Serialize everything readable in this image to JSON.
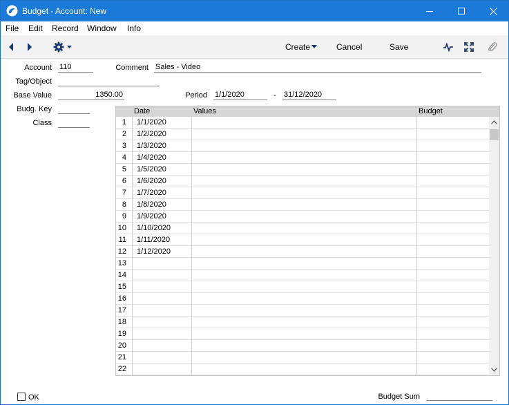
{
  "window": {
    "title": "Budget - Account: New"
  },
  "menu": [
    "File",
    "Edit",
    "Record",
    "Window",
    "Info"
  ],
  "toolbar": {
    "create_label": "Create",
    "cancel_label": "Cancel",
    "save_label": "Save"
  },
  "form": {
    "account_label": "Account",
    "account_value": "110",
    "comment_label": "Comment",
    "comment_value": "Sales - Video",
    "tag_label": "Tag/Object",
    "tag_value": "",
    "base_value_label": "Base Value",
    "base_value": "1350.00",
    "period_label": "Period",
    "period_from": "1/1/2020",
    "period_sep": "-",
    "period_to": "31/12/2020",
    "budg_key_label": "Budg. Key",
    "budg_key_value": "",
    "class_label": "Class",
    "class_value": ""
  },
  "grid": {
    "headers": {
      "date": "Date",
      "values": "Values",
      "budget": "Budget"
    },
    "rows": [
      {
        "num": "1",
        "date": "1/1/2020",
        "values": "",
        "budget": ""
      },
      {
        "num": "2",
        "date": "1/2/2020",
        "values": "",
        "budget": ""
      },
      {
        "num": "3",
        "date": "1/3/2020",
        "values": "",
        "budget": ""
      },
      {
        "num": "4",
        "date": "1/4/2020",
        "values": "",
        "budget": ""
      },
      {
        "num": "5",
        "date": "1/5/2020",
        "values": "",
        "budget": ""
      },
      {
        "num": "6",
        "date": "1/6/2020",
        "values": "",
        "budget": ""
      },
      {
        "num": "7",
        "date": "1/7/2020",
        "values": "",
        "budget": ""
      },
      {
        "num": "8",
        "date": "1/8/2020",
        "values": "",
        "budget": ""
      },
      {
        "num": "9",
        "date": "1/9/2020",
        "values": "",
        "budget": ""
      },
      {
        "num": "10",
        "date": "1/10/2020",
        "values": "",
        "budget": ""
      },
      {
        "num": "11",
        "date": "1/11/2020",
        "values": "",
        "budget": ""
      },
      {
        "num": "12",
        "date": "1/12/2020",
        "values": "",
        "budget": ""
      },
      {
        "num": "13",
        "date": "",
        "values": "",
        "budget": ""
      },
      {
        "num": "14",
        "date": "",
        "values": "",
        "budget": ""
      },
      {
        "num": "15",
        "date": "",
        "values": "",
        "budget": ""
      },
      {
        "num": "16",
        "date": "",
        "values": "",
        "budget": ""
      },
      {
        "num": "17",
        "date": "",
        "values": "",
        "budget": ""
      },
      {
        "num": "18",
        "date": "",
        "values": "",
        "budget": ""
      },
      {
        "num": "19",
        "date": "",
        "values": "",
        "budget": ""
      },
      {
        "num": "20",
        "date": "",
        "values": "",
        "budget": ""
      },
      {
        "num": "21",
        "date": "",
        "values": "",
        "budget": ""
      },
      {
        "num": "22",
        "date": "",
        "values": "",
        "budget": ""
      }
    ]
  },
  "footer": {
    "ok_label": "OK",
    "budget_sum_label": "Budget Sum",
    "budget_sum_value": ""
  },
  "colors": {
    "titlebar": "#1b7ad8",
    "toolbar": "#f2f2f2",
    "grid_header": "#d6d6d6"
  }
}
